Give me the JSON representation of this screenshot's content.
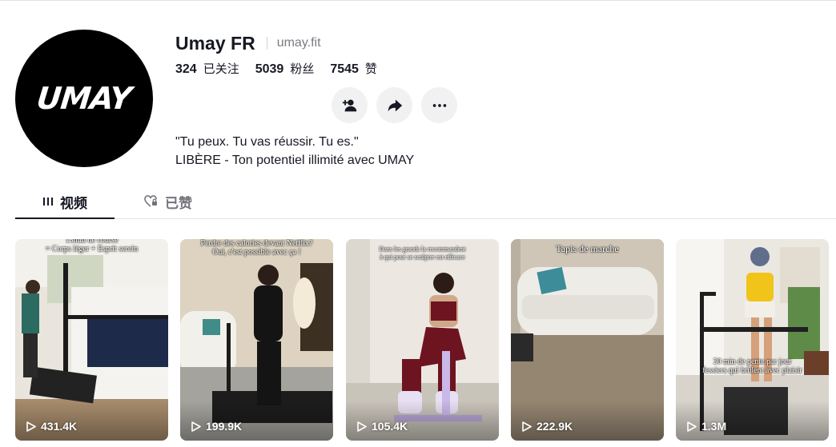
{
  "profile": {
    "avatar_text": "UMAY",
    "display_name": "Umay FR",
    "handle": "umay.fit",
    "stats": [
      {
        "value": "324",
        "label": "已关注"
      },
      {
        "value": "5039",
        "label": "粉丝"
      },
      {
        "value": "7545",
        "label": "赞"
      }
    ],
    "bio_line1": "\"Tu peux. Tu vas réussir. Tu es.\"",
    "bio_line2": "LIBÈRE - Ton potentiel illimité avec UMAY"
  },
  "actions": {
    "follow_icon": "person-add-icon",
    "share_icon": "share-arrow-icon",
    "more_icon": "more-dots-icon"
  },
  "tabs": {
    "videos": "视频",
    "liked": "已赞"
  },
  "videos": [
    {
      "caption": "15min de course\n= Corps léger + Esprit serein",
      "views": "431.4K"
    },
    {
      "caption": "Perdre des calories devant Netflix?\nOui, c'est possible avec ça !",
      "views": "199.9K"
    },
    {
      "caption": "Dans les grands la recommandent\nà qui pour se sculpter est efficace",
      "views": "105.4K"
    },
    {
      "caption": "Tapis de marche",
      "views": "222.9K"
    },
    {
      "caption": "30 min de pente par jour\nfessiers qui brûlent avec plaisir",
      "views": "1.3M"
    }
  ],
  "colors": {
    "text": "#161823",
    "muted": "#73747b",
    "button_bg": "#f1f1f2",
    "divider": "#e3e3e4"
  }
}
